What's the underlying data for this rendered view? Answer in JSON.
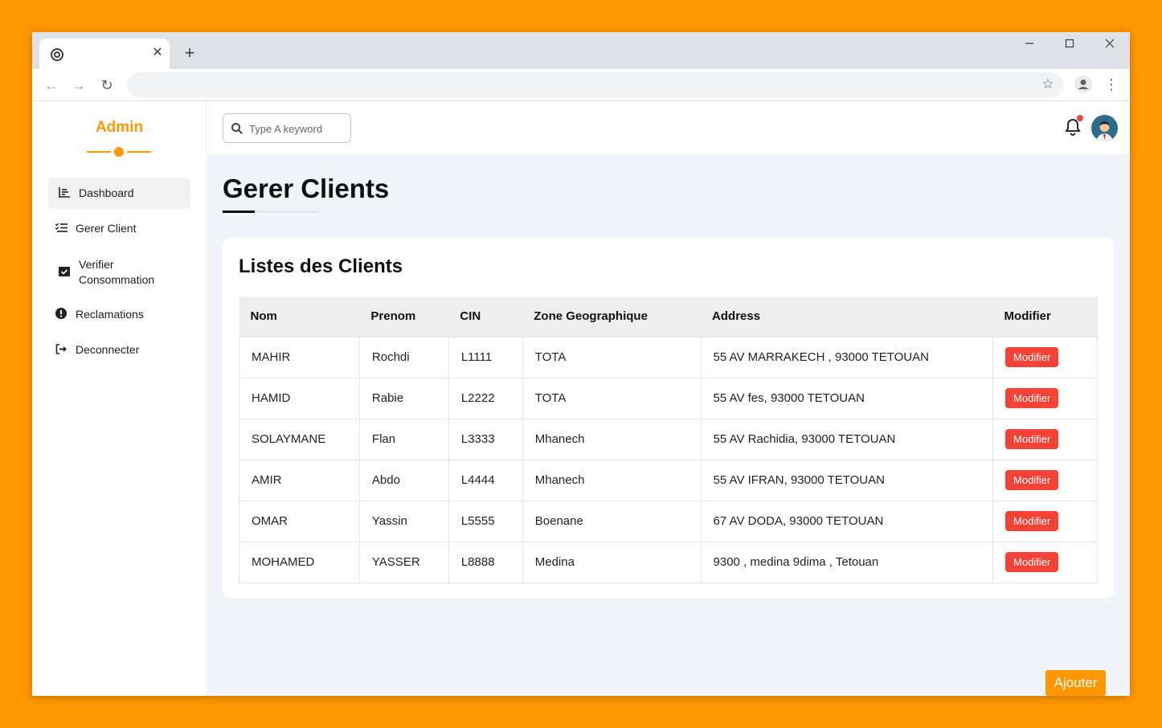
{
  "browser": {
    "new_tab_symbol": "+",
    "close_tab_symbol": "✕"
  },
  "sidebar": {
    "brand": "Admin",
    "items": [
      {
        "label": "Dashboard",
        "icon": "chart-icon"
      },
      {
        "label": "Gerer Client",
        "icon": "list-check-icon"
      },
      {
        "label": "Verifier Consommation",
        "icon": "calendar-check-icon"
      },
      {
        "label": "Reclamations",
        "icon": "exclamation-circle-icon"
      },
      {
        "label": "Deconnecter",
        "icon": "sign-out-icon"
      }
    ]
  },
  "topbar": {
    "search_placeholder": "Type A keyword"
  },
  "page": {
    "title": "Gerer Clients",
    "card_title": "Listes des Clients",
    "add_label": "Ajouter"
  },
  "table": {
    "headers": [
      "Nom",
      "Prenom",
      "CIN",
      "Zone Geographique",
      "Address",
      "Modifier"
    ],
    "rows": [
      [
        "MAHIR",
        "Rochdi",
        "L1111",
        "TOTA",
        "55 AV MARRAKECH , 93000 TETOUAN",
        "Modifier"
      ],
      [
        "HAMID",
        "Rabie",
        "L2222",
        "TOTA",
        "55 AV fes, 93000 TETOUAN",
        "Modifier"
      ],
      [
        "SOLAYMANE",
        "Flan",
        "L3333",
        "Mhanech",
        "55 AV Rachidia, 93000 TETOUAN",
        "Modifier"
      ],
      [
        "AMIR",
        "Abdo",
        "L4444",
        "Mhanech",
        "55 AV IFRAN, 93000 TETOUAN",
        "Modifier"
      ],
      [
        "OMAR",
        "Yassin",
        "L5555",
        "Boenane",
        "67 AV DODA, 93000 TETOUAN",
        "Modifier"
      ],
      [
        "MOHAMED",
        "YASSER",
        "L8888",
        "Medina",
        "9300 , medina 9dima , Tetouan",
        "Modifier"
      ]
    ]
  },
  "colors": {
    "accent": "#ff9800",
    "danger": "#f44336"
  }
}
